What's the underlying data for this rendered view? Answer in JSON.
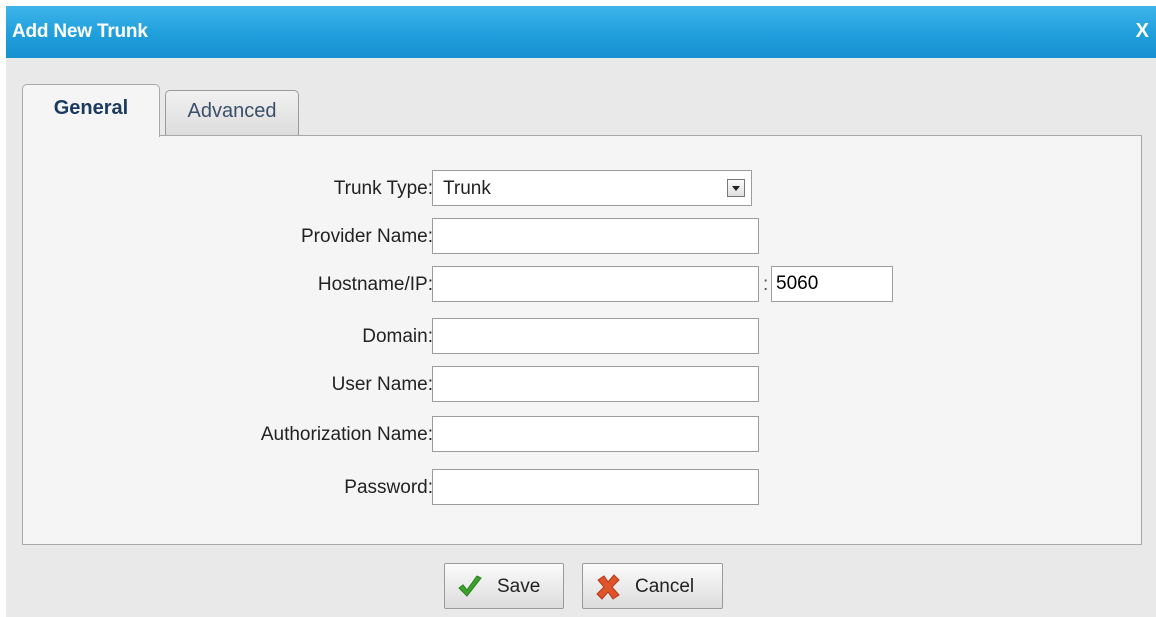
{
  "dialog": {
    "title": "Add New Trunk",
    "close_label": "X"
  },
  "tabs": [
    {
      "label": "General",
      "active": true
    },
    {
      "label": "Advanced",
      "active": false
    }
  ],
  "form": {
    "trunk_type": {
      "label": "Trunk Type:",
      "value": "Trunk"
    },
    "provider_name": {
      "label": "Provider Name:",
      "value": ""
    },
    "hostname": {
      "label": "Hostname/IP:",
      "value": "",
      "port_separator": ":",
      "port": "5060"
    },
    "domain": {
      "label": "Domain:",
      "value": ""
    },
    "user_name": {
      "label": "User Name:",
      "value": ""
    },
    "authorization_name": {
      "label": "Authorization Name:",
      "value": ""
    },
    "password": {
      "label": "Password:",
      "value": ""
    }
  },
  "buttons": {
    "save": {
      "label": "Save",
      "icon": "checkmark-icon"
    },
    "cancel": {
      "label": "Cancel",
      "icon": "x-icon"
    }
  },
  "colors": {
    "titlebar": "#1f9fdc",
    "save_icon": "#3aa52a",
    "cancel_icon": "#e0542a"
  }
}
